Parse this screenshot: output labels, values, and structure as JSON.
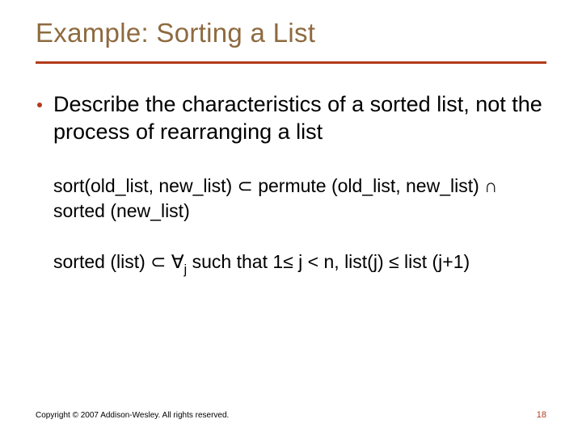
{
  "title": "Example: Sorting a List",
  "bullet": "Describe the characteristics of a sorted list, not the process of rearranging a list",
  "def1_a": "sort(old_list, new_list) ",
  "def1_sym1": "⊂",
  "def1_b": " permute (old_list, new_list) ",
  "def1_sym2": "∩",
  "def1_c": " sorted (new_list)",
  "def2_a": "sorted (list) ",
  "def2_sym1": "⊂",
  "def2_b": " ",
  "def2_forall": "∀",
  "def2_sub": "j",
  "def2_c": " such that 1",
  "def2_le1": "≤",
  "def2_d": " j < n, list(j) ",
  "def2_le2": "≤",
  "def2_e": " list (j+1)",
  "footer": "Copyright © 2007 Addison-Wesley. All rights reserved.",
  "page": "18"
}
